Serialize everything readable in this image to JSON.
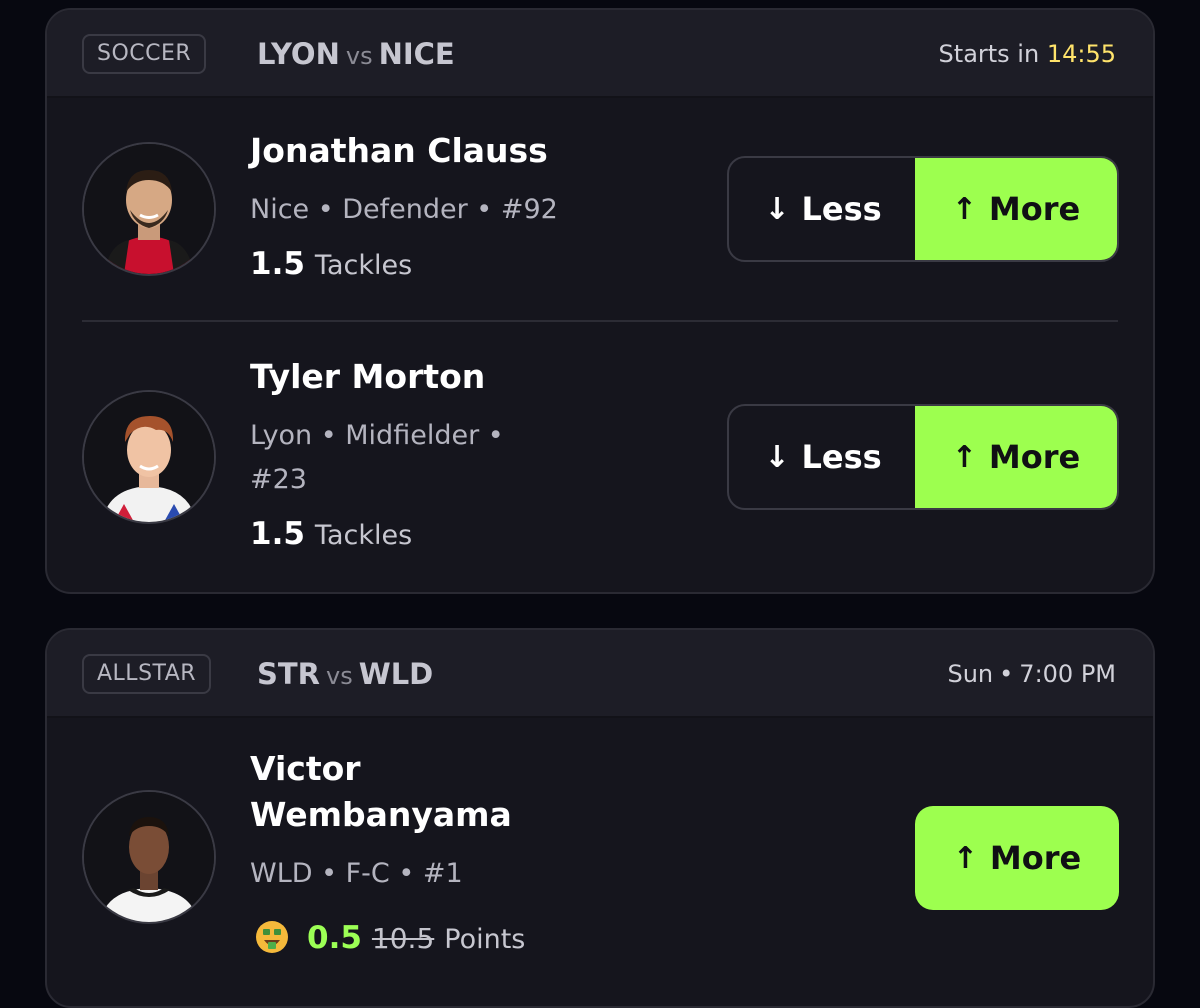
{
  "matches": [
    {
      "sport": "SOCCER",
      "team_a": "LYON",
      "vs": "vs",
      "team_b": "NICE",
      "starts_label": "Starts in",
      "starts_time": "14:55",
      "players": [
        {
          "name": "Jonathan Clauss",
          "meta": "Nice • Defender • #92",
          "line": "1.5",
          "stat": "Tackles",
          "less_label": "Less",
          "more_label": "More"
        },
        {
          "name": "Tyler Morton",
          "meta_line1": "Lyon • Midfielder •",
          "meta_line2": "#23",
          "line": "1.5",
          "stat": "Tackles",
          "less_label": "Less",
          "more_label": "More"
        }
      ]
    },
    {
      "sport": "ALLSTAR",
      "team_a": "STR",
      "vs": "vs",
      "team_b": "WLD",
      "day": "Sun",
      "time": "7:00 PM",
      "players": [
        {
          "name_line1": "Victor",
          "name_line2": "Wembanyama",
          "meta": "WLD • F-C • #1",
          "line": "0.5",
          "original_line": "10.5",
          "stat": "Points",
          "more_label": "More",
          "promo_icon": "money-mouth-face-icon"
        }
      ]
    }
  ],
  "colors": {
    "accent_green": "#9dff4f",
    "timer_yellow": "#ffe36b",
    "card_bg": "#15151d",
    "page_bg": "#070810"
  }
}
